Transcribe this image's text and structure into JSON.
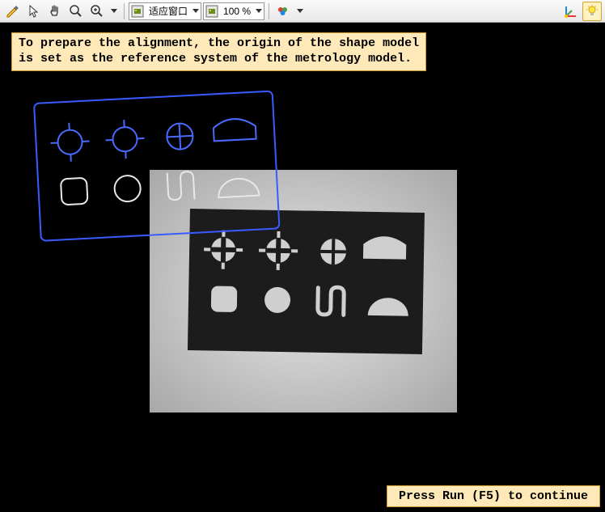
{
  "toolbar": {
    "zoom_combo_label": "适应窗口",
    "zoom_percent_label": "100 %"
  },
  "message": {
    "text": "To prepare the alignment, the origin of the shape model\nis set as the reference system of the metrology model."
  },
  "status": {
    "text": "Press Run (F5) to continue"
  }
}
